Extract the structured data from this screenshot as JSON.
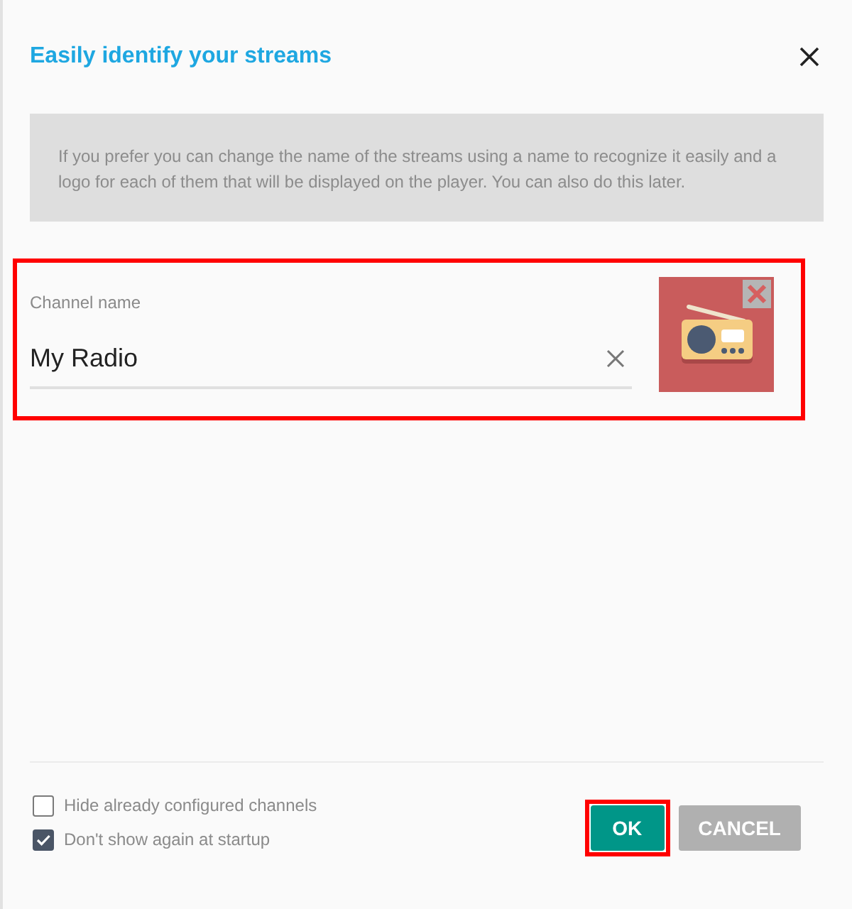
{
  "dialog": {
    "title": "Easily identify your streams",
    "info": "If you prefer you can change the name of the streams using a name to recognize it easily and a logo for each of them that will be displayed on the player. You can also do this later."
  },
  "channel": {
    "highlighted": true,
    "label": "Channel name",
    "value": "My Radio"
  },
  "options": [
    {
      "label": "Hide already configured channels",
      "checked": false
    },
    {
      "label": "Don't show again at startup",
      "checked": true
    }
  ],
  "buttons": [
    {
      "label": "OK",
      "kind": "primary",
      "highlighted": true
    },
    {
      "label": "CANCEL",
      "kind": "secondary",
      "highlighted": false
    }
  ]
}
